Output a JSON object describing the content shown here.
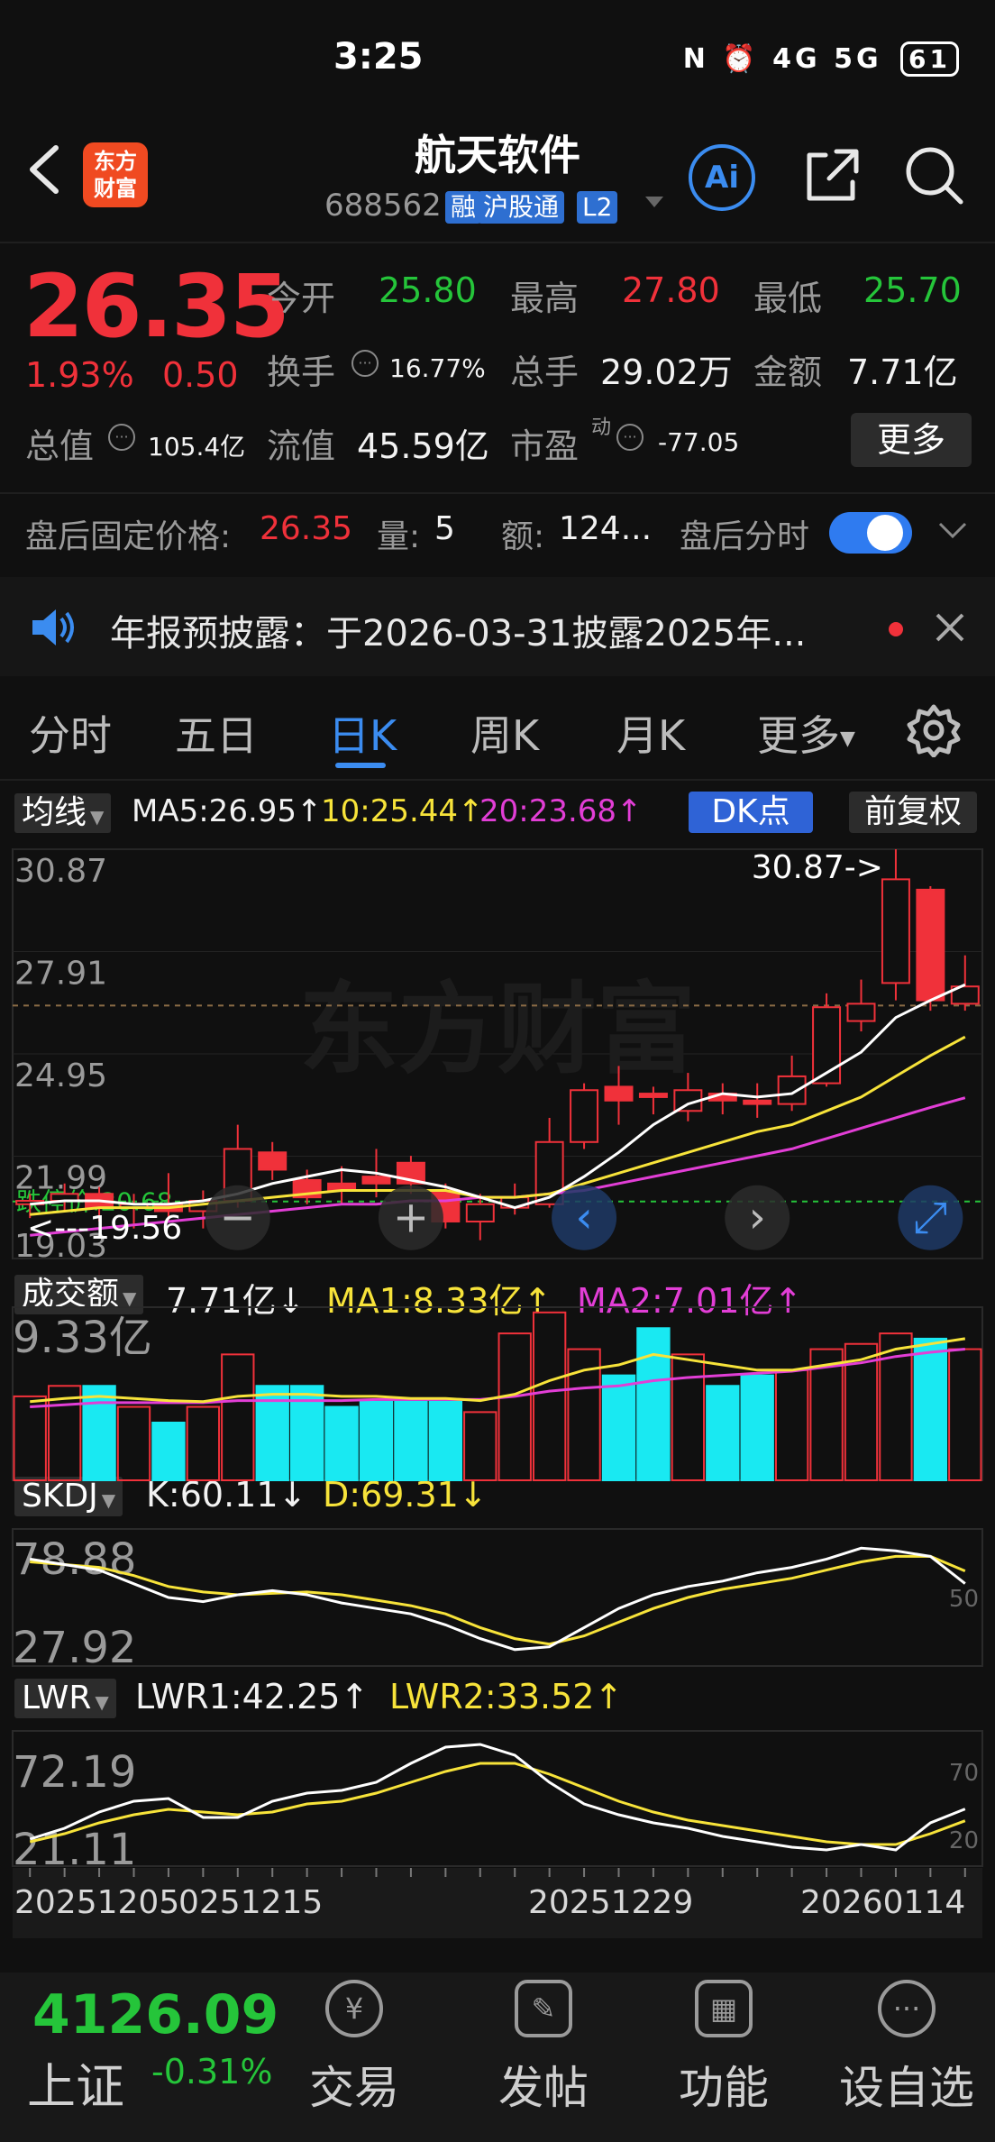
{
  "status_bar": {
    "time": "3:25",
    "icons_text": "N ⏰ 4G 5G",
    "battery": "61"
  },
  "header": {
    "stock_name": "航天软件",
    "stock_code": "688562",
    "tags": [
      "融",
      "沪股通",
      "L2"
    ],
    "logo_text": "东方\n财富",
    "ai_label": "Ai"
  },
  "quote": {
    "price": "26.35",
    "change_pct": "1.93%",
    "change_amt": "0.50",
    "open_label": "今开",
    "open": "25.80",
    "high_label": "最高",
    "high": "27.80",
    "low_label": "最低",
    "low": "25.70",
    "turnover_label": "换手",
    "turnover": "16.77%",
    "volume_label": "总手",
    "volume": "29.02万",
    "amount_label": "金额",
    "amount": "7.71亿",
    "mktcap_label": "总值",
    "mktcap": "105.4亿",
    "float_label": "流值",
    "float": "45.59亿",
    "pe_label": "市盈",
    "pe_sup": "动",
    "pe": "-77.05",
    "more_label": "更多"
  },
  "after_hours": {
    "price_label": "盘后固定价格:",
    "price": "26.35",
    "qty_label": "量:",
    "qty": "5",
    "amt_label": "额:",
    "amt": "124...",
    "intraday_label": "盘后分时",
    "toggle_on": true
  },
  "notice": {
    "text": "年报预披露：于2026-03-31披露2025年..."
  },
  "tabs": [
    {
      "label": "分时",
      "active": false
    },
    {
      "label": "五日",
      "active": false
    },
    {
      "label": "日K",
      "active": true
    },
    {
      "label": "周K",
      "active": false
    },
    {
      "label": "月K",
      "active": false
    },
    {
      "label": "更多",
      "active": false
    }
  ],
  "ma_row": {
    "button": "均线",
    "ma5": "MA5:26.95↑",
    "ma10": "10:25.44↑",
    "ma20": "20:23.68↑",
    "dk_button": "DK点",
    "fq_button": "前复权"
  },
  "vol_row": {
    "button": "成交额",
    "value": "7.71亿↓",
    "ma1": "MA1:8.33亿↑",
    "ma2": "MA2:7.01亿↑"
  },
  "skdj_row": {
    "button": "SKDJ",
    "k": "K:60.11↓",
    "d": "D:69.31↓"
  },
  "lwr_row": {
    "button": "LWR",
    "lwr1": "LWR1:42.25↑",
    "lwr2": "LWR2:33.52↑"
  },
  "colors": {
    "up": "#f0313a",
    "down": "#25c53a",
    "cyan": "#19e9f2",
    "ma5": "#ffffff",
    "ma10": "#f7e33a",
    "ma20": "#e23ed6",
    "accent": "#3b8cf0"
  },
  "bottom_bar": {
    "index_value": "4126.09",
    "index_name": "上证",
    "index_change": "-0.31%",
    "nav": [
      {
        "label": "交易",
        "icon": "yen-refresh-icon"
      },
      {
        "label": "发帖",
        "icon": "edit-icon"
      },
      {
        "label": "功能",
        "icon": "grid-icon"
      },
      {
        "label": "设自选",
        "icon": "more-dots-icon"
      }
    ]
  },
  "chart_data": [
    {
      "type": "candlestick",
      "title": "",
      "y_ticks": [
        "30.87",
        "27.91",
        "24.95",
        "21.99",
        "19.03"
      ],
      "ylim": [
        19.03,
        30.87
      ],
      "annotations": {
        "max": "30.87->",
        "min": "<---19.56",
        "limit_down": "跌停价:20.68",
        "watermark": "东方财富"
      },
      "candles": [
        {
          "o": 20.6,
          "c": 20.7,
          "h": 20.9,
          "l": 20.2,
          "v": 0.8
        },
        {
          "o": 20.7,
          "c": 20.9,
          "h": 21.2,
          "l": 20.4,
          "v": 0.9
        },
        {
          "o": 20.9,
          "c": 20.5,
          "h": 21.1,
          "l": 20.1,
          "v": 0.9
        },
        {
          "o": 20.5,
          "c": 20.6,
          "h": 20.9,
          "l": 19.9,
          "v": 0.7
        },
        {
          "o": 20.6,
          "c": 20.4,
          "h": 21.5,
          "l": 20.1,
          "v": 0.55
        },
        {
          "o": 20.4,
          "c": 20.7,
          "h": 21.0,
          "l": 19.9,
          "v": 0.7
        },
        {
          "o": 20.7,
          "c": 22.2,
          "h": 22.9,
          "l": 20.5,
          "v": 1.2
        },
        {
          "o": 22.1,
          "c": 21.6,
          "h": 22.4,
          "l": 21.3,
          "v": 0.9
        },
        {
          "o": 21.3,
          "c": 20.8,
          "h": 21.6,
          "l": 20.6,
          "v": 0.9
        },
        {
          "o": 21.2,
          "c": 21.0,
          "h": 21.7,
          "l": 20.6,
          "v": 0.7
        },
        {
          "o": 21.4,
          "c": 21.2,
          "h": 22.2,
          "l": 20.8,
          "v": 0.75
        },
        {
          "o": 21.8,
          "c": 21.2,
          "h": 22.0,
          "l": 20.9,
          "v": 0.75
        },
        {
          "o": 21.0,
          "c": 20.1,
          "h": 21.2,
          "l": 19.9,
          "v": 0.75
        },
        {
          "o": 20.1,
          "c": 20.6,
          "h": 20.9,
          "l": 19.56,
          "v": 0.65
        },
        {
          "o": 20.5,
          "c": 20.8,
          "h": 21.2,
          "l": 20.3,
          "v": 1.4
        },
        {
          "o": 20.6,
          "c": 22.4,
          "h": 23.1,
          "l": 20.5,
          "v": 1.6
        },
        {
          "o": 22.4,
          "c": 23.9,
          "h": 24.1,
          "l": 22.2,
          "v": 1.25
        },
        {
          "o": 24.0,
          "c": 23.6,
          "h": 24.6,
          "l": 22.9,
          "v": 1.0
        },
        {
          "o": 23.8,
          "c": 23.7,
          "h": 24.0,
          "l": 23.2,
          "v": 1.45
        },
        {
          "o": 23.3,
          "c": 23.9,
          "h": 24.4,
          "l": 23.0,
          "v": 1.2
        },
        {
          "o": 23.8,
          "c": 23.6,
          "h": 24.1,
          "l": 23.2,
          "v": 0.9
        },
        {
          "o": 23.6,
          "c": 23.5,
          "h": 24.1,
          "l": 23.1,
          "v": 1.0
        },
        {
          "o": 23.5,
          "c": 24.3,
          "h": 24.9,
          "l": 23.3,
          "v": 1.05
        },
        {
          "o": 24.1,
          "c": 26.3,
          "h": 26.7,
          "l": 24.0,
          "v": 1.25
        },
        {
          "o": 25.9,
          "c": 26.4,
          "h": 27.1,
          "l": 25.6,
          "v": 1.3
        },
        {
          "o": 27.0,
          "c": 30.0,
          "h": 30.87,
          "l": 26.5,
          "v": 1.4
        },
        {
          "o": 29.7,
          "c": 26.5,
          "h": 29.8,
          "l": 26.2,
          "v": 1.35
        },
        {
          "o": 26.4,
          "c": 26.9,
          "h": 27.8,
          "l": 26.2,
          "v": 1.25
        }
      ],
      "ma5": [
        20.6,
        20.7,
        20.7,
        20.6,
        20.6,
        20.7,
        20.9,
        21.2,
        21.4,
        21.6,
        21.5,
        21.3,
        21.1,
        20.8,
        20.5,
        20.8,
        21.4,
        22.1,
        22.9,
        23.5,
        23.8,
        23.7,
        23.8,
        24.4,
        25.0,
        26.0,
        26.5,
        26.95
      ],
      "ma10": [
        20.3,
        20.4,
        20.5,
        20.5,
        20.5,
        20.6,
        20.7,
        20.8,
        20.9,
        21.0,
        21.0,
        21.0,
        21.0,
        20.8,
        20.8,
        20.9,
        21.2,
        21.5,
        21.8,
        22.1,
        22.4,
        22.7,
        22.9,
        23.3,
        23.7,
        24.3,
        24.9,
        25.44
      ],
      "ma20": [
        19.7,
        19.8,
        19.9,
        20.0,
        20.1,
        20.2,
        20.3,
        20.4,
        20.5,
        20.6,
        20.6,
        20.7,
        20.7,
        20.8,
        20.8,
        20.9,
        21.0,
        21.2,
        21.4,
        21.6,
        21.8,
        22.0,
        22.2,
        22.5,
        22.8,
        23.1,
        23.4,
        23.68
      ]
    },
    {
      "type": "bar",
      "title": "成交额",
      "y_tick": "9.33亿",
      "values": [
        0.8,
        0.9,
        0.9,
        0.7,
        0.55,
        0.7,
        1.2,
        0.9,
        0.9,
        0.7,
        0.75,
        0.75,
        0.75,
        0.65,
        1.4,
        1.6,
        1.25,
        1.0,
        1.45,
        1.2,
        0.9,
        1.0,
        1.05,
        1.25,
        1.3,
        1.4,
        1.35,
        1.25
      ],
      "ma1": [
        0.75,
        0.78,
        0.8,
        0.78,
        0.76,
        0.75,
        0.8,
        0.82,
        0.82,
        0.8,
        0.8,
        0.78,
        0.78,
        0.76,
        0.82,
        0.95,
        1.05,
        1.1,
        1.2,
        1.15,
        1.1,
        1.05,
        1.05,
        1.1,
        1.15,
        1.25,
        1.3,
        1.35
      ],
      "ma2": [
        0.7,
        0.72,
        0.74,
        0.74,
        0.74,
        0.74,
        0.76,
        0.76,
        0.76,
        0.76,
        0.77,
        0.77,
        0.77,
        0.77,
        0.8,
        0.85,
        0.88,
        0.9,
        0.95,
        0.98,
        1.0,
        1.02,
        1.04,
        1.08,
        1.12,
        1.18,
        1.22,
        1.25
      ]
    },
    {
      "type": "line",
      "title": "SKDJ",
      "y_ticks": [
        "78.88",
        "27.92"
      ],
      "right_tick": "50",
      "K": [
        78,
        74,
        70,
        60,
        50,
        47,
        52,
        55,
        52,
        46,
        42,
        38,
        30,
        20,
        12,
        14,
        28,
        42,
        52,
        58,
        62,
        68,
        72,
        78,
        86,
        84,
        80,
        60.11
      ],
      "D": [
        76,
        74,
        72,
        66,
        58,
        54,
        52,
        53,
        54,
        52,
        48,
        44,
        38,
        28,
        20,
        16,
        22,
        32,
        42,
        50,
        56,
        60,
        64,
        70,
        76,
        80,
        80,
        69.31
      ]
    },
    {
      "type": "line",
      "title": "LWR",
      "y_ticks": [
        "72.19",
        "21.11"
      ],
      "right_ticks": [
        "70",
        "20"
      ],
      "LWR1": [
        20,
        28,
        40,
        48,
        50,
        36,
        36,
        48,
        54,
        56,
        62,
        76,
        88,
        90,
        82,
        62,
        46,
        38,
        32,
        28,
        22,
        18,
        14,
        12,
        16,
        12,
        32,
        42.25
      ],
      "LWR2": [
        18,
        24,
        32,
        38,
        42,
        40,
        38,
        40,
        46,
        48,
        54,
        62,
        70,
        76,
        76,
        68,
        58,
        48,
        40,
        34,
        30,
        26,
        22,
        18,
        16,
        16,
        24,
        33.52
      ]
    }
  ],
  "x_axis": {
    "labels": [
      "20251205",
      "0251215",
      "20251229",
      "20260114"
    ]
  }
}
